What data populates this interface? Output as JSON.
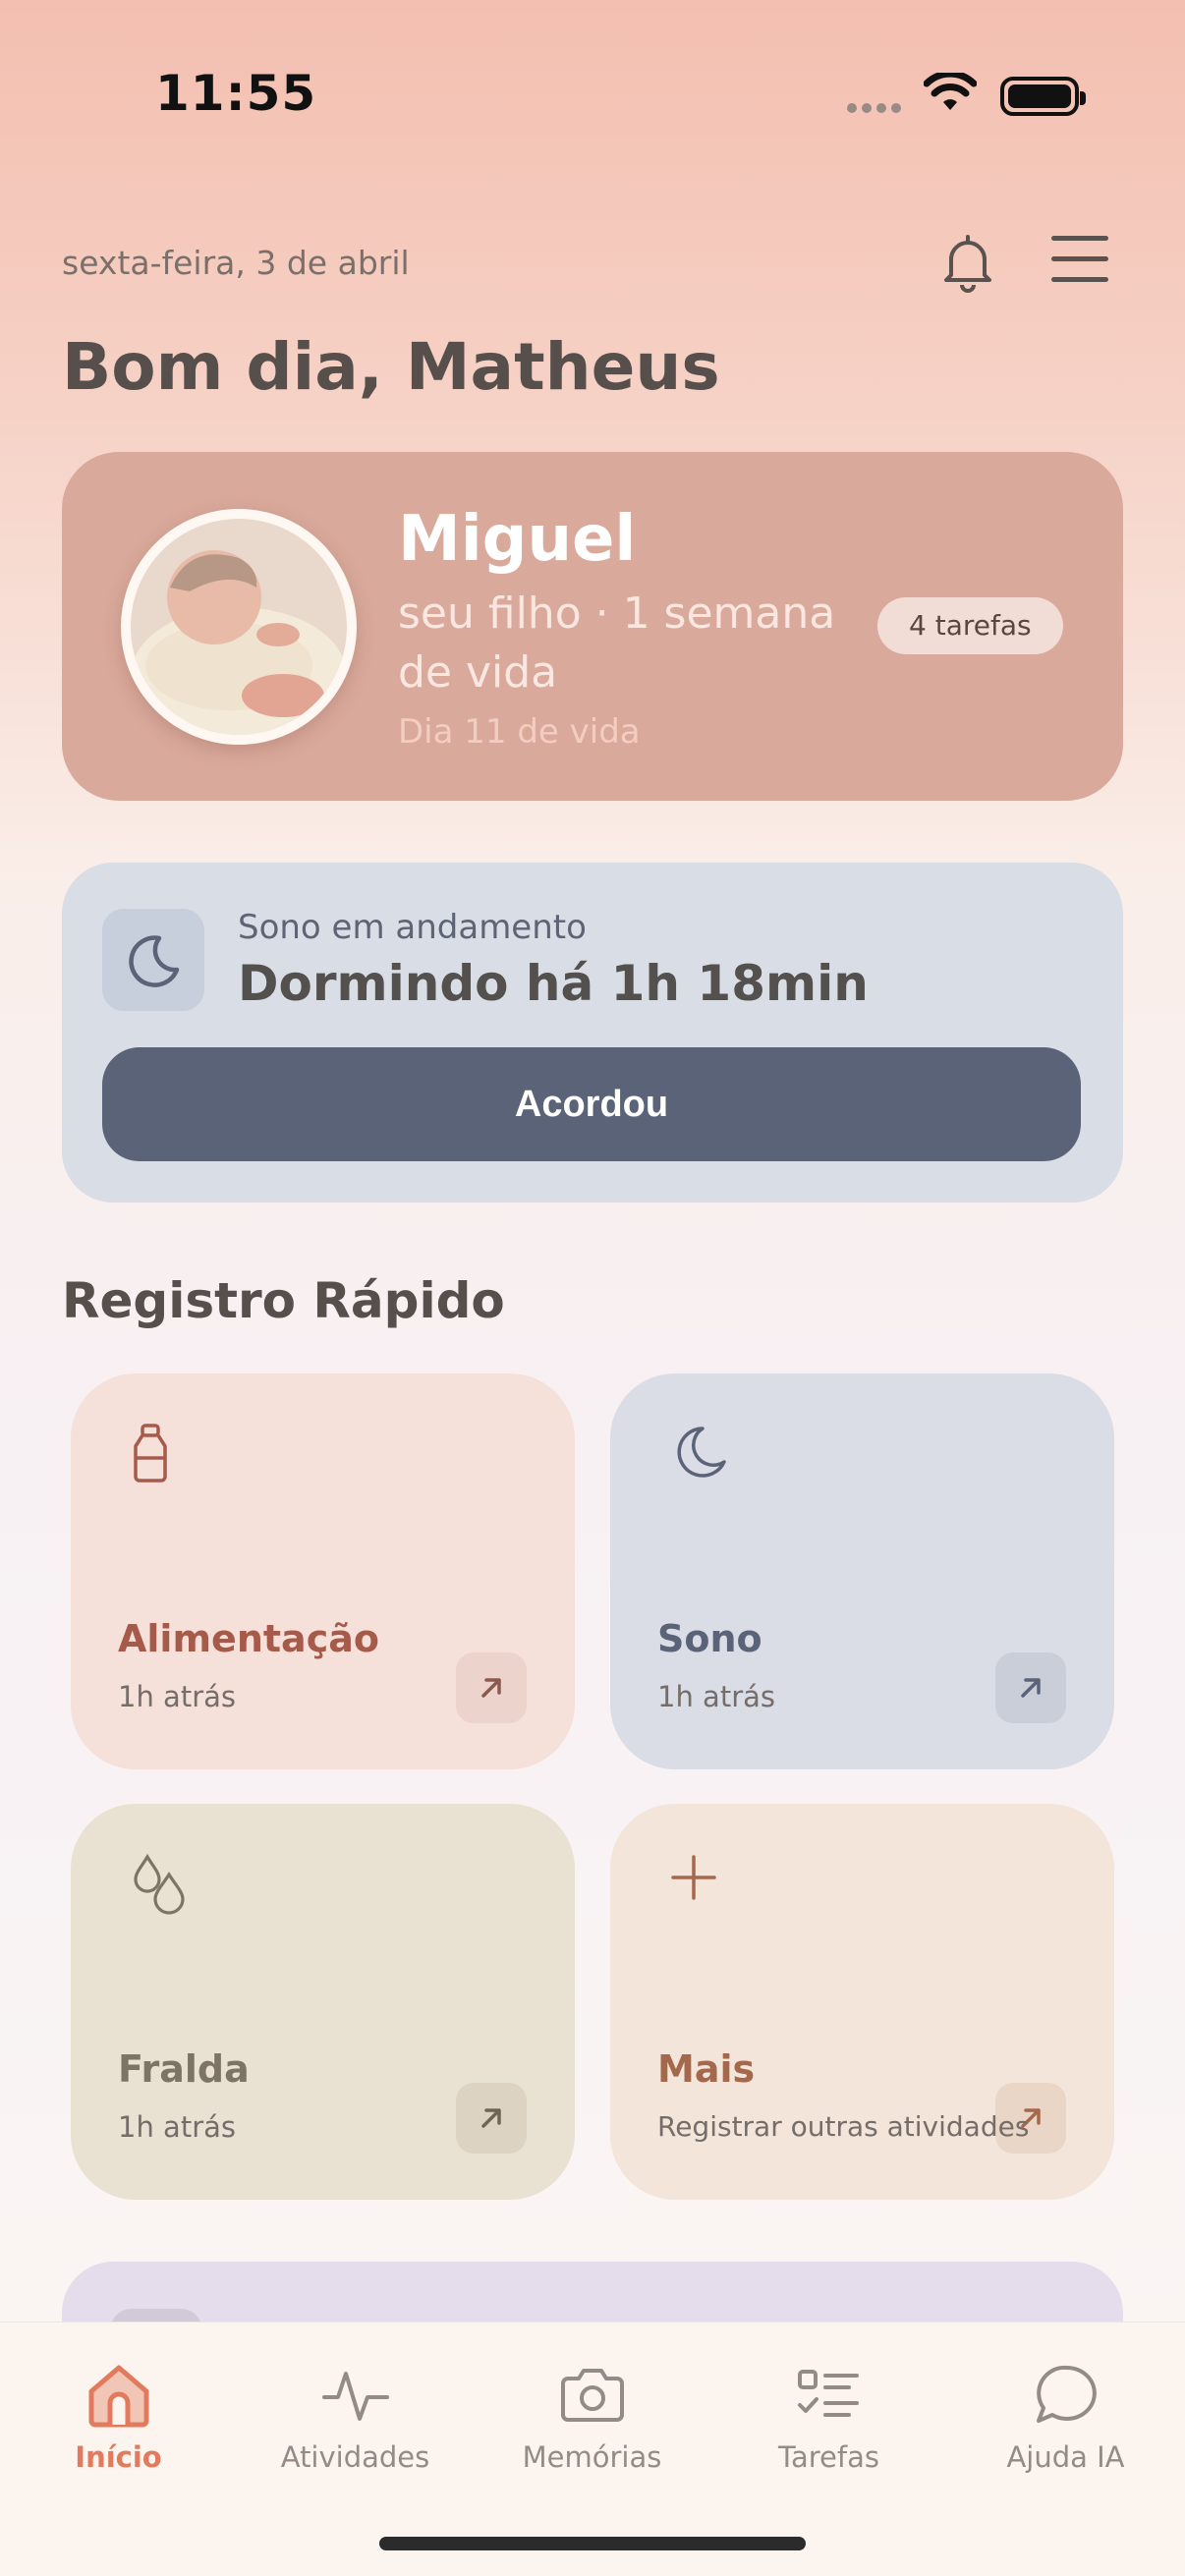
{
  "status_bar": {
    "time": "11:55"
  },
  "header": {
    "date": "sexta-feira, 3 de abril",
    "greeting": "Bom dia, Matheus"
  },
  "child_card": {
    "name": "Miguel",
    "subtitle": "seu filho · 1 semana de vida",
    "day": "Dia 11 de vida",
    "tasks_badge": "4 tarefas"
  },
  "sleep_card": {
    "label": "Sono em andamento",
    "status": "Dormindo há 1h 18min",
    "button": "Acordou"
  },
  "quick_log": {
    "title": "Registro Rápido",
    "tiles": [
      {
        "title": "Alimentação",
        "subtitle": "1h atrás",
        "icon": "bottle-icon",
        "color": "#a65a4a"
      },
      {
        "title": "Sono",
        "subtitle": "1h atrás",
        "icon": "moon-icon",
        "color": "#5b6378"
      },
      {
        "title": "Fralda",
        "subtitle": "1h atrás",
        "icon": "drops-icon",
        "color": "#7e7465"
      },
      {
        "title": "Mais",
        "subtitle": "Registrar outras atividades",
        "icon": "plus-icon",
        "color": "#a4684c"
      }
    ]
  },
  "bottom_nav": {
    "items": [
      {
        "label": "Início",
        "icon": "home-icon",
        "active": true
      },
      {
        "label": "Atividades",
        "icon": "activity-icon",
        "active": false
      },
      {
        "label": "Memórias",
        "icon": "camera-icon",
        "active": false
      },
      {
        "label": "Tarefas",
        "icon": "tasks-icon",
        "active": false
      },
      {
        "label": "Ajuda IA",
        "icon": "chat-icon",
        "active": false
      }
    ]
  },
  "colors": {
    "accent": "#e27a5e",
    "sleep_button": "#5b6378",
    "child_card": "#d9a99b"
  }
}
